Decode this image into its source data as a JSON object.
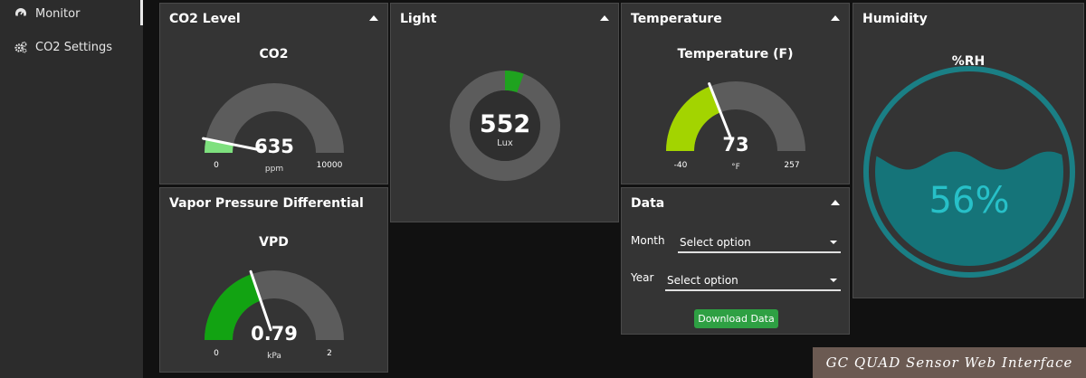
{
  "sidebar": {
    "items": [
      {
        "label": "Monitor",
        "icon": "dashboard-icon",
        "active": true
      },
      {
        "label": "CO2 Settings",
        "icon": "gears-icon",
        "active": false
      }
    ]
  },
  "co2": {
    "card_title": "CO2 Level",
    "gauge_title": "CO2",
    "value": "635",
    "value_num": 635,
    "unit": "ppm",
    "min": "0",
    "max": "10000",
    "min_num": 0,
    "max_num": 10000,
    "fill_color": "#7ee07e",
    "track_color": "#5c5c5c"
  },
  "light": {
    "card_title": "Light",
    "value": "552",
    "value_num": 552,
    "unit": "Lux",
    "max_num": 10000,
    "fill_color": "#1fa31f",
    "track_color": "#5c5c5c"
  },
  "temperature": {
    "card_title": "Temperature",
    "gauge_title": "Temperature (F)",
    "value": "73",
    "value_num": 73,
    "unit": "°F",
    "min": "-40",
    "max": "257",
    "min_num": -40,
    "max_num": 257,
    "fill_color": "#a3d400",
    "track_color": "#5c5c5c"
  },
  "humidity": {
    "card_title": "Humidity",
    "gauge_title": "%RH",
    "value": "56%",
    "value_num": 56,
    "ring_color": "#1a7f85",
    "water_color": "#157479",
    "text_color": "#27c0c8"
  },
  "vpd": {
    "card_title": "Vapor Pressure Differential",
    "gauge_title": "VPD",
    "value": "0.79",
    "value_num": 0.79,
    "unit": "kPa",
    "min": "0",
    "max": "2",
    "min_num": 0,
    "max_num": 2,
    "fill_color": "#12a312",
    "track_color": "#5c5c5c"
  },
  "data_panel": {
    "card_title": "Data",
    "month_label": "Month",
    "month_value": "Select option",
    "year_label": "Year",
    "year_value": "Select option",
    "download_label": "Download Data"
  },
  "watermark": "GC QUAD Sensor Web Interface"
}
